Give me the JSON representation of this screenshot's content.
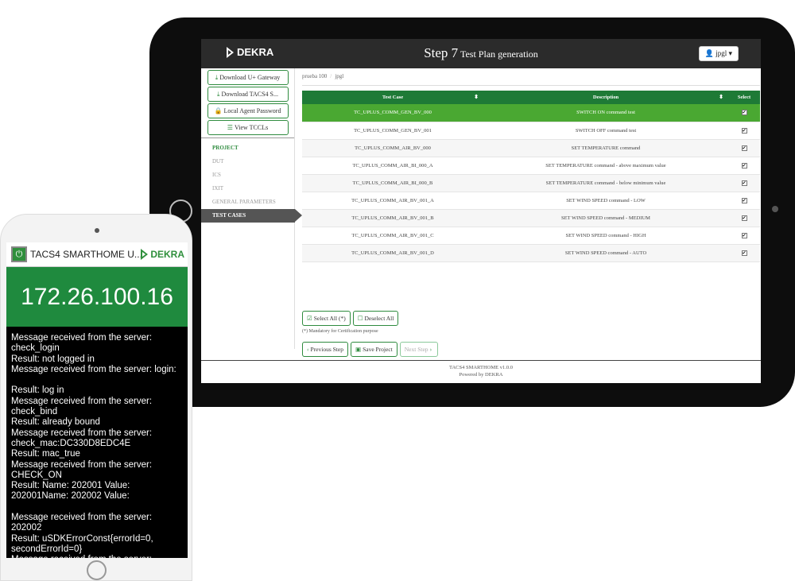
{
  "tablet": {
    "brand": "DEKRA",
    "step_big": "Step 7",
    "step_small": "Test Plan generation",
    "user": "jpgl ▾",
    "sidebar": {
      "buttons": [
        "Download U+ Gateway",
        "Download TACS4 S...",
        "Local Agent Password",
        "View TCCLs"
      ],
      "section_title": "PROJECT",
      "items": [
        "DUT",
        "ICS",
        "IXIT",
        "GENERAL PARAMETERS",
        "TEST CASES"
      ]
    },
    "breadcrumb": [
      "prueba 100",
      "jpgl"
    ],
    "table": {
      "headers": [
        "Test Case",
        "Description",
        "Select"
      ],
      "rows": [
        {
          "tc": "TC_UPLUS_COMM_GEN_BV_000",
          "desc": "SWITCH ON command test",
          "checked": "✔"
        },
        {
          "tc": "TC_UPLUS_COMM_GEN_BV_001",
          "desc": "SWITCH OFF command test",
          "checked": "✔"
        },
        {
          "tc": "TC_UPLUS_COMM_AIR_BV_000",
          "desc": "SET TEMPERATURE command",
          "checked": "✔"
        },
        {
          "tc": "TC_UPLUS_COMM_AIR_BI_000_A",
          "desc": "SET TEMPERATURE command - above maximum value",
          "checked": "✔"
        },
        {
          "tc": "TC_UPLUS_COMM_AIR_BI_000_B",
          "desc": "SET TEMPERATURE command - below minimum value",
          "checked": "✔"
        },
        {
          "tc": "TC_UPLUS_COMM_AIR_BV_001_A",
          "desc": "SET WIND SPEED command - LOW",
          "checked": "✔"
        },
        {
          "tc": "TC_UPLUS_COMM_AIR_BV_001_B",
          "desc": "SET WIND SPEED command - MEDIUM",
          "checked": "✔"
        },
        {
          "tc": "TC_UPLUS_COMM_AIR_BV_001_C",
          "desc": "SET WIND SPEED command - HIGH",
          "checked": "✔"
        },
        {
          "tc": "TC_UPLUS_COMM_AIR_BV_001_D",
          "desc": "SET WIND SPEED command - AUTO",
          "checked": "✔"
        }
      ]
    },
    "select_all": "Select All (*)",
    "deselect_all": "Deselect All",
    "note": "(*) Mandatory for Certification purpose",
    "previous": "Previous Step",
    "save": "Save Project",
    "next": "Next Step",
    "footer_line1": "TACS4 SMARTHOME v1.0.0",
    "footer_line2": "Powered by DEKRA"
  },
  "phone": {
    "app_title": "TACS4 SMARTHOME U...",
    "brand": "DEKRA",
    "ip": "172.26.100.16",
    "log": [
      "Message received from the server:",
      "check_login",
      "Result: not logged in",
      "Message received from the server: login:",
      "",
      "Result: log in",
      "Message received from the server:",
      "check_bind",
      "Result: already bound",
      "Message received from the server:",
      "check_mac:DC330D8EDC4E",
      "Result: mac_true",
      "Message received from the server:",
      "CHECK_ON",
      "Result: Name: 202001 Value:",
      "202001Name: 202002 Value:",
      "",
      "Message received from the server: 202002",
      "Result: uSDKErrorConst{errorId=0,",
      "secondErrorId=0}",
      "Message received from the server:"
    ]
  },
  "colors": {
    "brand_green": "#1f8a3e",
    "selected_row": "#4aa832",
    "topbar": "#2b2b2b"
  }
}
